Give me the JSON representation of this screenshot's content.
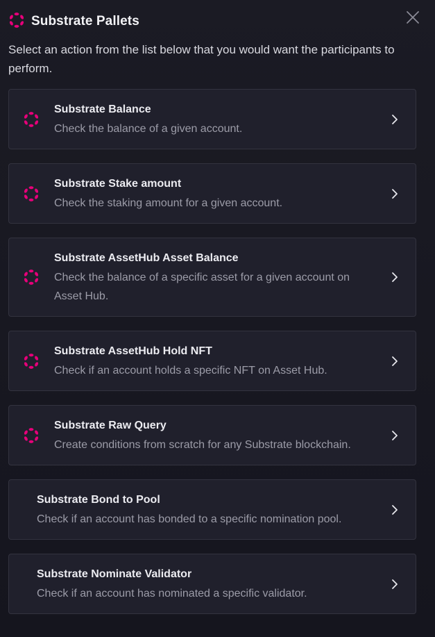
{
  "header": {
    "title": "Substrate Pallets",
    "logo_icon": "polkadot-icon",
    "close_icon": "close-icon",
    "accent": "#e6007a"
  },
  "subtitle": "Select an action from the list below that you would want the participants to perform.",
  "actions": [
    {
      "title": "Substrate Balance",
      "description": "Check the balance of a given account.",
      "icon": "polkadot-icon"
    },
    {
      "title": "Substrate Stake amount",
      "description": "Check the staking amount for a given account.",
      "icon": "polkadot-icon"
    },
    {
      "title": "Substrate AssetHub Asset Balance",
      "description": "Check the balance of a specific asset for a given account on Asset Hub.",
      "icon": "polkadot-icon"
    },
    {
      "title": "Substrate AssetHub Hold NFT",
      "description": "Check if an account holds a specific NFT on Asset Hub.",
      "icon": "polkadot-icon"
    },
    {
      "title": "Substrate Raw Query",
      "description": "Create conditions from scratch for any Substrate blockchain.",
      "icon": "polkadot-icon"
    },
    {
      "title": "Substrate Bond to Pool",
      "description": "Check if an account has bonded to a specific nomination pool.",
      "icon": null
    },
    {
      "title": "Substrate Nominate Validator",
      "description": "Check if an account has nominated a specific validator.",
      "icon": null
    }
  ]
}
